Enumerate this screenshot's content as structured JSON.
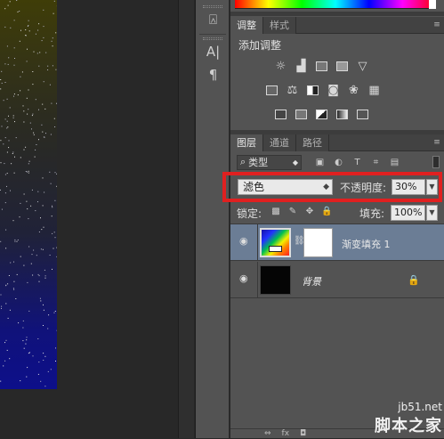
{
  "left_strip": {
    "icons": [
      "stamp-icon",
      "character-icon",
      "paragraph-icon"
    ],
    "glyphs": [
      "⍓",
      "A|",
      "¶"
    ]
  },
  "adjustments_panel": {
    "tabs": [
      "调整",
      "样式"
    ],
    "title": "添加调整",
    "row1": [
      "brightness-icon",
      "levels-icon",
      "curves-icon",
      "exposure-icon",
      "vibrance-icon"
    ],
    "row2": [
      "hue-saturation-icon",
      "color-balance-icon",
      "black-white-icon",
      "photo-filter-icon",
      "channel-mixer-icon",
      "color-lookup-icon"
    ],
    "row3": [
      "invert-icon",
      "posterize-icon",
      "threshold-icon",
      "gradient-map-icon",
      "selective-color-icon"
    ]
  },
  "layers_panel": {
    "tabs": [
      "图层",
      "通道",
      "路径"
    ],
    "filter_label": "类型",
    "blend_mode": "滤色",
    "opacity_label": "不透明度:",
    "opacity_value": "30%",
    "lock_label": "锁定:",
    "fill_label": "填充:",
    "fill_value": "100%",
    "layers": [
      {
        "name": "渐变填充 1",
        "selected": true
      },
      {
        "name": "背景",
        "locked": true
      }
    ],
    "bottom_icons": [
      "link-icon",
      "fx-icon",
      "mask-icon"
    ]
  },
  "watermark": {
    "site": "jb51.net",
    "brand": "脚本之家"
  },
  "colors": {
    "highlight": "#e02020",
    "selected_layer": "#6b7d95",
    "panel_bg": "#535353"
  }
}
